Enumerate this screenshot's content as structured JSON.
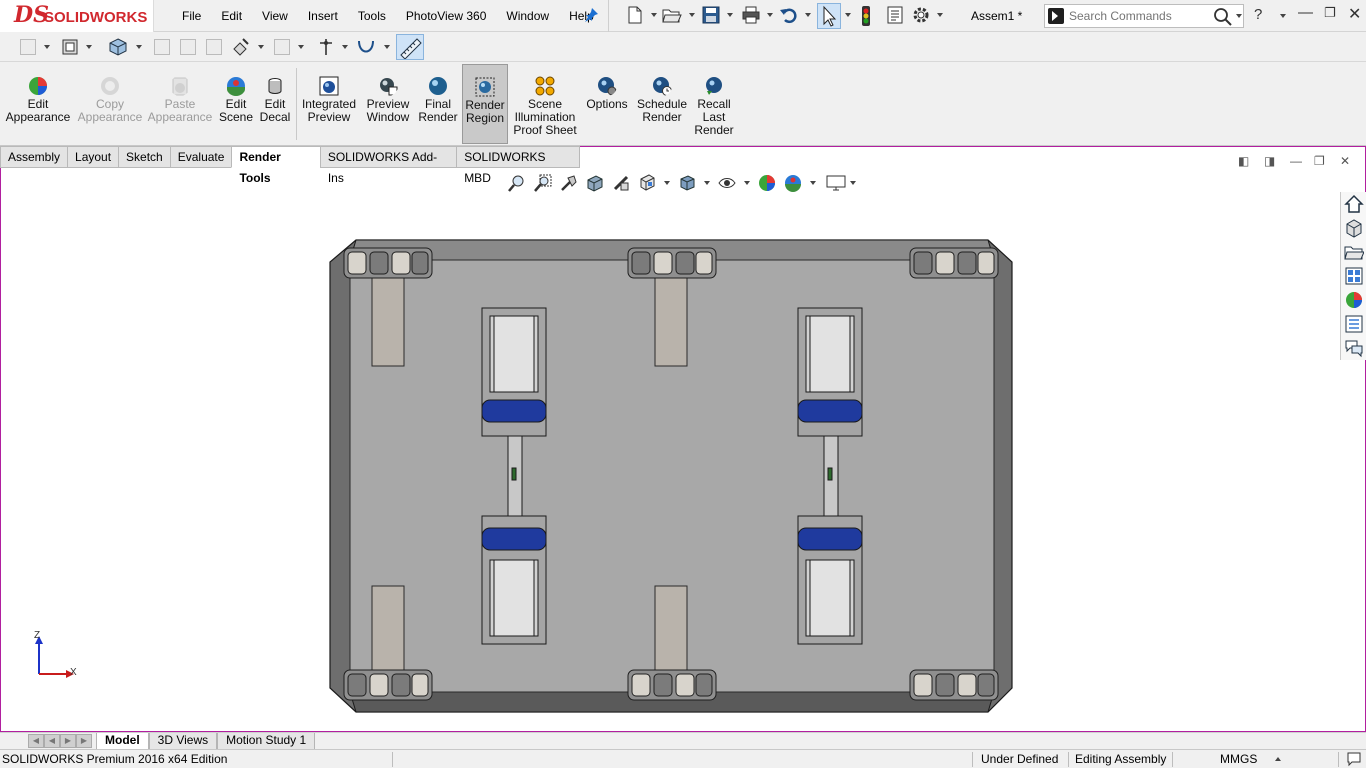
{
  "app": {
    "brand_ds": "DS",
    "brand_name": "SOLIDWORKS",
    "document_title": "Assem1 *",
    "accent_color": "#d1282e"
  },
  "menu": [
    "File",
    "Edit",
    "View",
    "Insert",
    "Tools",
    "PhotoView 360",
    "Window",
    "Help"
  ],
  "search": {
    "placeholder": "Search Commands",
    "value": ""
  },
  "command_manager": {
    "buttons": [
      {
        "id": "edit-appearance",
        "line1": "Edit",
        "line2": "Appearance",
        "line3": "",
        "disabled": false,
        "active": false,
        "icon": "appearance-ball-icon"
      },
      {
        "id": "copy-appearance",
        "line1": "Copy",
        "line2": "Appearance",
        "line3": "",
        "disabled": true,
        "active": false,
        "icon": "copy-appearance-icon"
      },
      {
        "id": "paste-appearance",
        "line1": "Paste",
        "line2": "Appearance",
        "line3": "",
        "disabled": true,
        "active": false,
        "icon": "paste-appearance-icon"
      },
      {
        "id": "edit-scene",
        "line1": "Edit",
        "line2": "Scene",
        "line3": "",
        "disabled": false,
        "active": false,
        "icon": "scene-icon"
      },
      {
        "id": "edit-decal",
        "line1": "Edit",
        "line2": "Decal",
        "line3": "",
        "disabled": false,
        "active": false,
        "icon": "decal-icon"
      },
      {
        "id": "integrated-preview",
        "line1": "Integrated",
        "line2": "Preview",
        "line3": "",
        "disabled": false,
        "active": false,
        "icon": "integrated-preview-icon"
      },
      {
        "id": "preview-window",
        "line1": "Preview",
        "line2": "Window",
        "line3": "",
        "disabled": false,
        "active": false,
        "icon": "preview-window-icon"
      },
      {
        "id": "final-render",
        "line1": "Final",
        "line2": "Render",
        "line3": "",
        "disabled": false,
        "active": false,
        "icon": "final-render-icon"
      },
      {
        "id": "render-region",
        "line1": "Render",
        "line2": "Region",
        "line3": "",
        "disabled": false,
        "active": true,
        "icon": "render-region-icon"
      },
      {
        "id": "scene-illumination",
        "line1": "Scene",
        "line2": "Illumination",
        "line3": "Proof Sheet",
        "disabled": false,
        "active": false,
        "icon": "illumination-icon"
      },
      {
        "id": "options",
        "line1": "Options",
        "line2": "",
        "line3": "",
        "disabled": false,
        "active": false,
        "icon": "options-icon"
      },
      {
        "id": "schedule-render",
        "line1": "Schedule",
        "line2": "Render",
        "line3": "",
        "disabled": false,
        "active": false,
        "icon": "schedule-render-icon"
      },
      {
        "id": "recall-last-render",
        "line1": "Recall",
        "line2": "Last",
        "line3": "Render",
        "disabled": false,
        "active": false,
        "icon": "recall-render-icon"
      }
    ]
  },
  "tabs": [
    {
      "label": "Assembly",
      "active": false
    },
    {
      "label": "Layout",
      "active": false
    },
    {
      "label": "Sketch",
      "active": false
    },
    {
      "label": "Evaluate",
      "active": false
    },
    {
      "label": "Render Tools",
      "active": true
    },
    {
      "label": "SOLIDWORKS Add-Ins",
      "active": false
    },
    {
      "label": "SOLIDWORKS MBD",
      "active": false
    }
  ],
  "triad": {
    "z_label": "Z",
    "x_label": "X"
  },
  "bottom_tabs": [
    {
      "label": "Model",
      "active": true
    },
    {
      "label": "3D Views",
      "active": false
    },
    {
      "label": "Motion Study 1",
      "active": false
    }
  ],
  "status": {
    "edition": "SOLIDWORKS Premium 2016 x64 Edition",
    "definition": "Under Defined",
    "mode": "Editing Assembly",
    "units": "MMGS"
  },
  "colors": {
    "viewport_border": "#b11f9f",
    "plate": "#a8a8a8",
    "frame": "#6e6e6e",
    "motor_blue": "#1f3a9e"
  }
}
